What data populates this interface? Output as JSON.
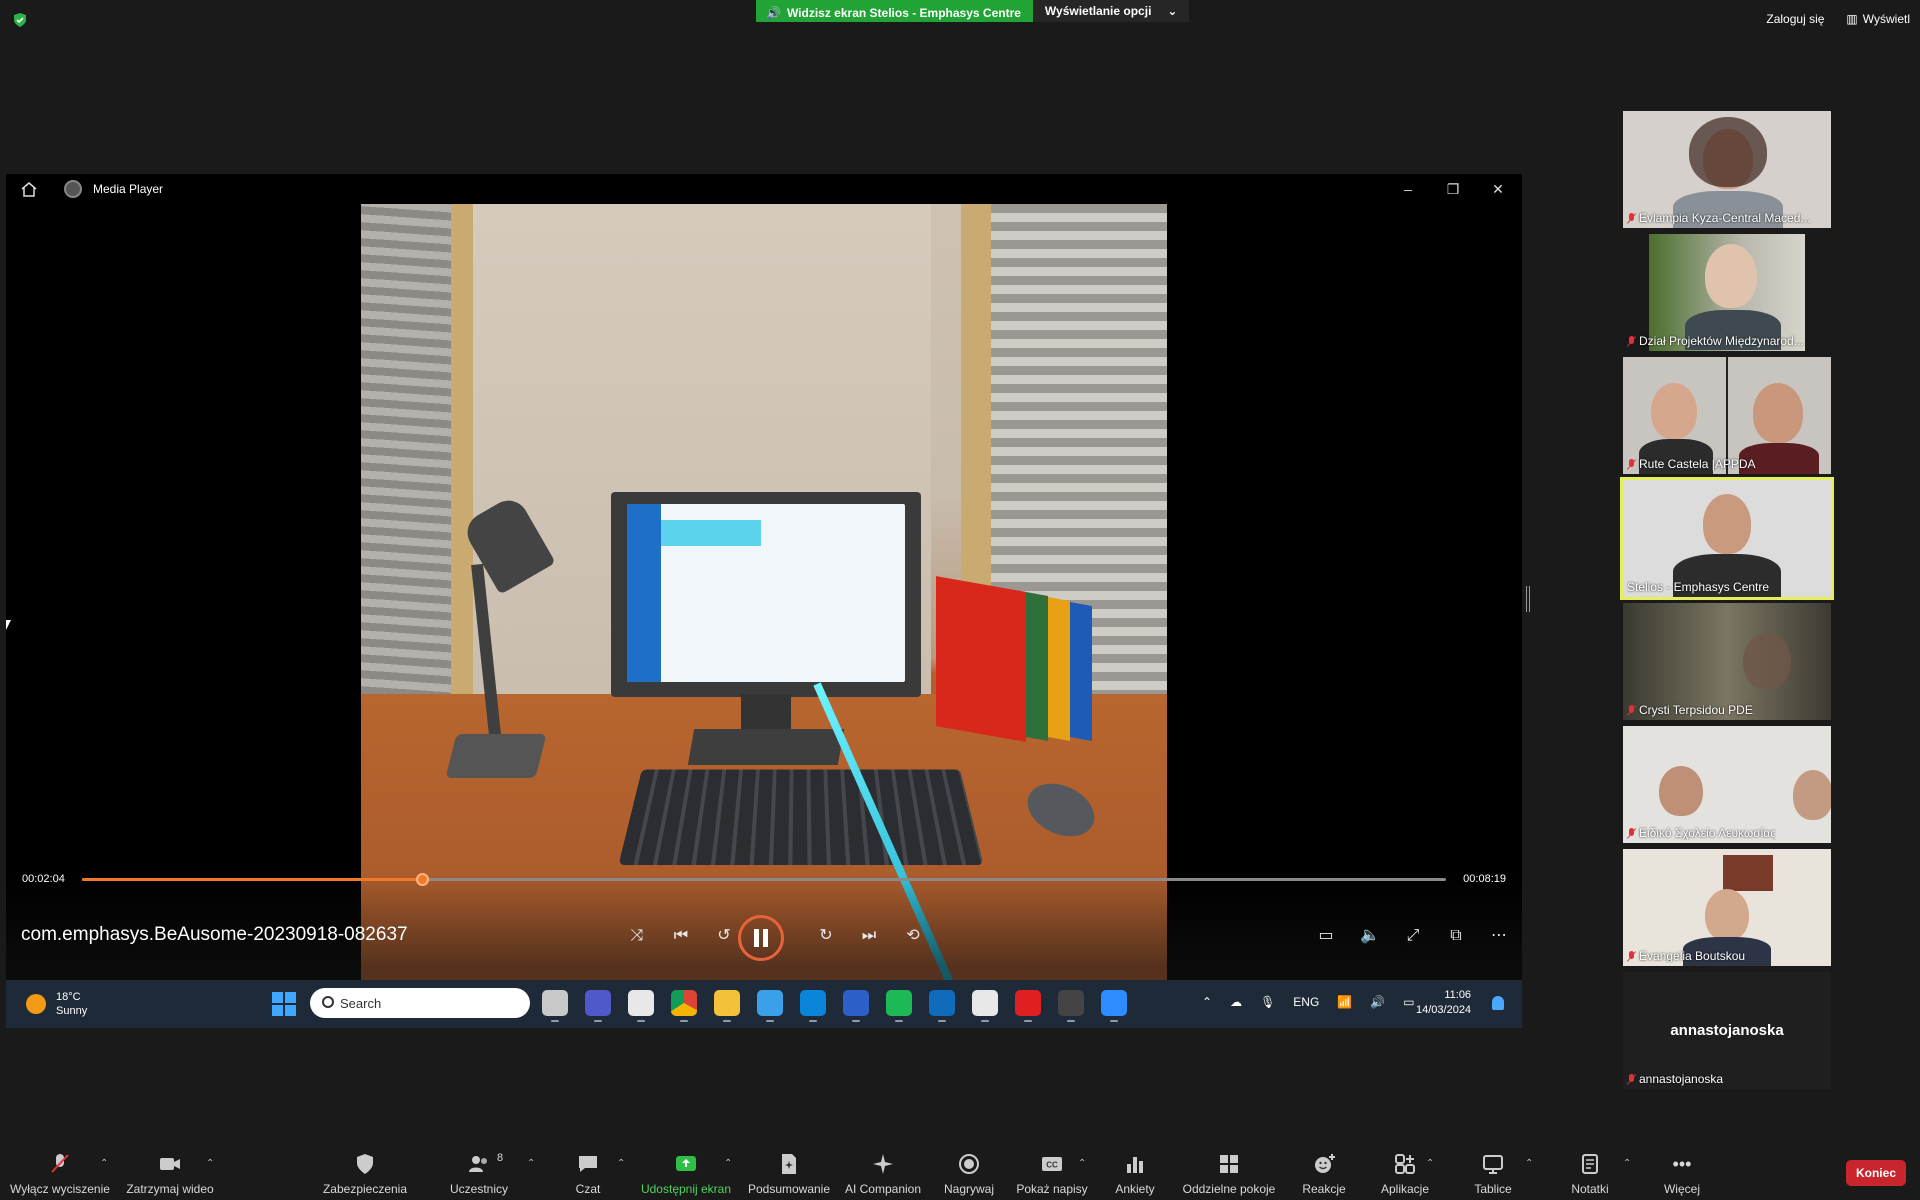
{
  "topbar": {
    "share_text": "Widzisz ekran Stelios - Emphasys Centre",
    "view_options": "Wyświetlanie opcji",
    "sign_in": "Zaloguj się",
    "view": "Wyświetl"
  },
  "media_player": {
    "title": "Media Player",
    "current_time": "00:02:04",
    "total_time": "00:08:19",
    "progress": 0.249,
    "file_name": "com.emphasys.BeAusome-20230918-082637"
  },
  "taskbar": {
    "temperature": "18°C",
    "weather": "Sunny",
    "search_placeholder": "Search",
    "language": "ENG",
    "time": "11:06",
    "date": "14/03/2024"
  },
  "participants": [
    {
      "name": "Evlampia Kyza-Central Maced...",
      "muted": true
    },
    {
      "name": "Dział Projektów Międzynarod...",
      "muted": true
    },
    {
      "name": "Rute Castela |APPDA",
      "muted": true
    },
    {
      "name": "Stelios - Emphasys Centre",
      "muted": false,
      "active": true
    },
    {
      "name": "Crysti Terpsidou PDE",
      "muted": true
    },
    {
      "name": "Ειδικό Σχολείο Λευκωσίας",
      "muted": true
    },
    {
      "name": "Evangelia Boutskou",
      "muted": true
    },
    {
      "name": "annastojanoska",
      "muted": true,
      "display_name": "annastojanoska"
    }
  ],
  "toolbar": {
    "mute": "Wyłącz wyciszenie",
    "video": "Zatrzymaj wideo",
    "security": "Zabezpieczenia",
    "participants": "Uczestnicy",
    "participants_count": "8",
    "chat": "Czat",
    "share": "Udostępnij ekran",
    "summary": "Podsumowanie",
    "ai": "AI Companion",
    "record": "Nagrywaj",
    "captions": "Pokaż napisy",
    "polls": "Ankiety",
    "breakout": "Oddzielne pokoje",
    "reactions": "Reakcje",
    "apps": "Aplikacje",
    "whiteboards": "Tablice",
    "notes": "Notatki",
    "more": "Więcej",
    "end": "Koniec"
  },
  "colors": {
    "share_green": "#21a336",
    "accent_orange": "#f07a2a",
    "active_speaker": "#e3f05c",
    "end_red": "#c9252d"
  }
}
